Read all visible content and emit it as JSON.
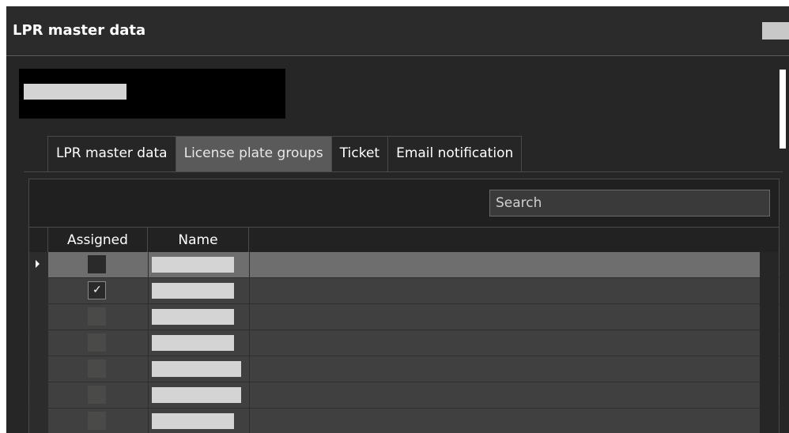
{
  "window": {
    "title": "LPR master data"
  },
  "tabs": [
    {
      "label": "LPR master data",
      "active": false
    },
    {
      "label": "License plate groups",
      "active": true
    },
    {
      "label": "Ticket",
      "active": false
    },
    {
      "label": "Email notification",
      "active": false
    }
  ],
  "search": {
    "placeholder": "Search",
    "value": ""
  },
  "grid": {
    "columns": [
      "Assigned",
      "Name"
    ],
    "rows": [
      {
        "assigned": false,
        "selected": true
      },
      {
        "assigned": true,
        "selected": false
      },
      {
        "assigned": false,
        "selected": false
      },
      {
        "assigned": false,
        "selected": false
      },
      {
        "assigned": false,
        "selected": false
      },
      {
        "assigned": false,
        "selected": false
      },
      {
        "assigned": false,
        "selected": false
      }
    ]
  },
  "icons": {
    "checkmark": "✓",
    "row_indicator": "triangle-right"
  },
  "colors": {
    "window_bg": "#262626",
    "tab_active_bg": "#5a5a5a",
    "row_bg": "#404040",
    "row_selected_bg": "#6e6e6e"
  }
}
